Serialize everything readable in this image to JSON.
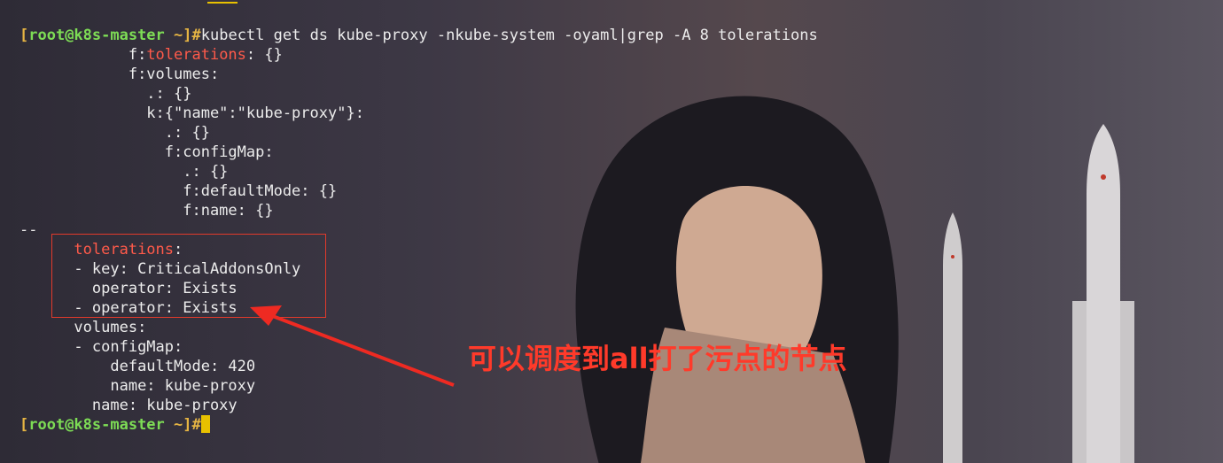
{
  "terminal": {
    "prompt": {
      "open_bracket": "[",
      "user_host": "root@k8s-master",
      "dir": " ~",
      "close_bracket": "]#"
    },
    "command": "kubectl get ds kube-proxy -nkube-system -oyaml|grep -A 8 tolerations",
    "lines": [
      {
        "indent": "            ",
        "pre": "f:",
        "hl": "tolerations",
        "post": ": {}"
      },
      {
        "indent": "            ",
        "text": "f:volumes:"
      },
      {
        "indent": "              ",
        "text": ".: {}"
      },
      {
        "indent": "              ",
        "text": "k:{\"name\":\"kube-proxy\"}:"
      },
      {
        "indent": "                ",
        "text": ".: {}"
      },
      {
        "indent": "                ",
        "text": "f:configMap:"
      },
      {
        "indent": "                  ",
        "text": ".: {}"
      },
      {
        "indent": "                  ",
        "text": "f:defaultMode: {}"
      },
      {
        "indent": "                  ",
        "text": "f:name: {}"
      },
      {
        "indent": "",
        "text": "--"
      },
      {
        "indent": "      ",
        "hl": "tolerations",
        "post": ":"
      },
      {
        "indent": "      ",
        "text": "- key: CriticalAddonsOnly"
      },
      {
        "indent": "        ",
        "text": "operator: Exists"
      },
      {
        "indent": "      ",
        "text": "- operator: Exists"
      },
      {
        "indent": "      ",
        "text": "volumes:"
      },
      {
        "indent": "      ",
        "text": "- configMap:"
      },
      {
        "indent": "          ",
        "text": "defaultMode: 420"
      },
      {
        "indent": "          ",
        "text": "name: kube-proxy"
      },
      {
        "indent": "        ",
        "text": "name: kube-proxy"
      }
    ]
  },
  "annotation": {
    "text": "可以调度到all打了污点的节点",
    "color": "#ff3a2a"
  },
  "colors": {
    "prompt_bracket": "#e5b443",
    "prompt_user": "#7ddc55",
    "highlight": "#ff5a4a",
    "cursor": "#e8c100"
  }
}
